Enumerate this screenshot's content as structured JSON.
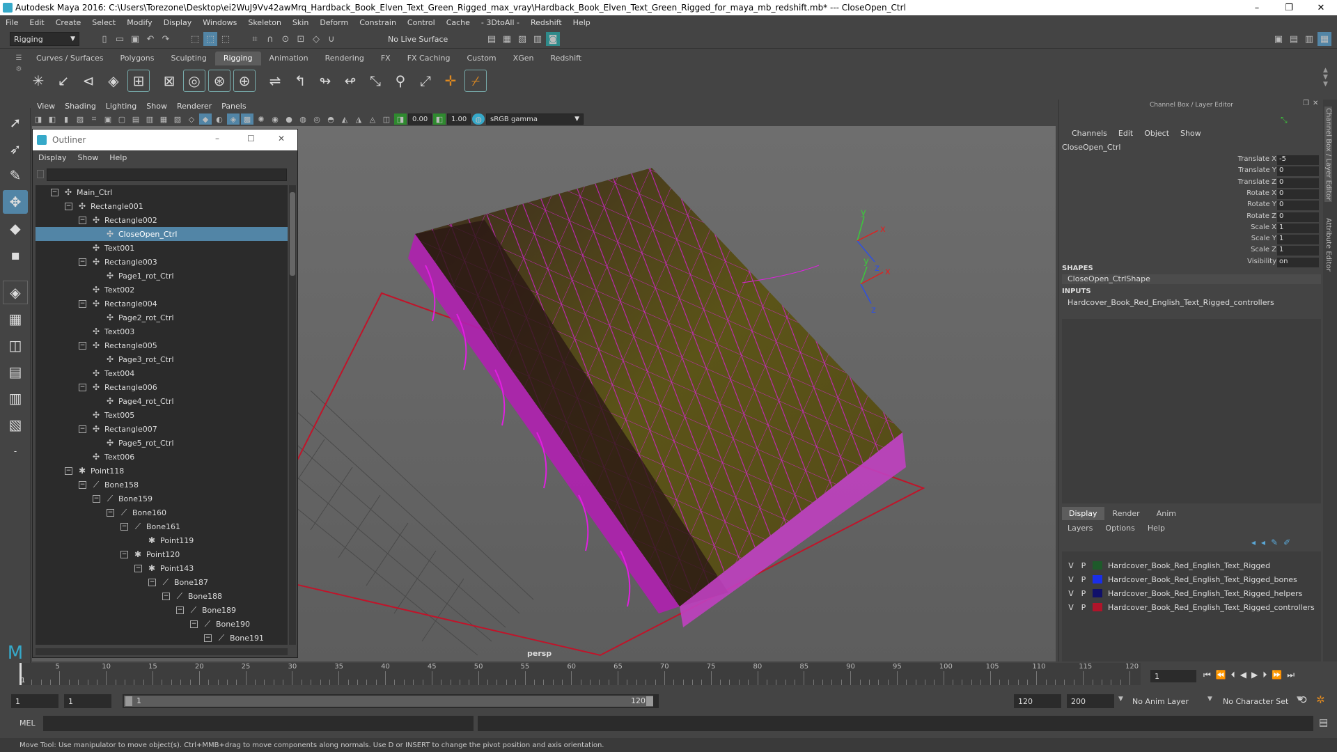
{
  "window": {
    "title": "Autodesk Maya 2016: C:\\Users\\Torezone\\Desktop\\ei2WuJ9Vv42awMrq_Hardback_Book_Elven_Text_Green_Rigged_max_vray\\Hardback_Book_Elven_Text_Green_Rigged_for_maya_mb_redshift.mb*   ---   CloseOpen_Ctrl",
    "minimize": "–",
    "maximize": "❐",
    "close": "✕"
  },
  "menubar": [
    "File",
    "Edit",
    "Create",
    "Select",
    "Modify",
    "Display",
    "Windows",
    "Skeleton",
    "Skin",
    "Deform",
    "Constrain",
    "Control",
    "Cache",
    "- 3DtoAll -",
    "Redshift",
    "Help"
  ],
  "toolbar": {
    "mode": "Rigging",
    "live_surface": "No Live Surface"
  },
  "shelf_tabs": [
    "Curves / Surfaces",
    "Polygons",
    "Sculpting",
    "Rigging",
    "Animation",
    "Rendering",
    "FX",
    "FX Caching",
    "Custom",
    "XGen",
    "Redshift"
  ],
  "shelf_active": "Rigging",
  "viewport": {
    "menu": [
      "View",
      "Shading",
      "Lighting",
      "Show",
      "Renderer",
      "Panels"
    ],
    "exposure": "0.00",
    "gamma": "1.00",
    "colorspace": "sRGB gamma",
    "camera_label": "persp"
  },
  "outliner": {
    "title": "Outliner",
    "menu": [
      "Display",
      "Show",
      "Help"
    ],
    "items": [
      {
        "label": "Main_Ctrl",
        "depth": 0,
        "icon": "nurbs-curve-icon",
        "expander": "−"
      },
      {
        "label": "Rectangle001",
        "depth": 1,
        "icon": "nurbs-curve-icon",
        "expander": "−"
      },
      {
        "label": "Rectangle002",
        "depth": 2,
        "icon": "nurbs-curve-icon",
        "expander": "−"
      },
      {
        "label": "CloseOpen_Ctrl",
        "depth": 3,
        "icon": "nurbs-curve-icon",
        "expander": "",
        "selected": true
      },
      {
        "label": "Text001",
        "depth": 2,
        "icon": "nurbs-curve-icon",
        "expander": ""
      },
      {
        "label": "Rectangle003",
        "depth": 2,
        "icon": "nurbs-curve-icon",
        "expander": "−"
      },
      {
        "label": "Page1_rot_Ctrl",
        "depth": 3,
        "icon": "nurbs-curve-icon",
        "expander": ""
      },
      {
        "label": "Text002",
        "depth": 2,
        "icon": "nurbs-curve-icon",
        "expander": ""
      },
      {
        "label": "Rectangle004",
        "depth": 2,
        "icon": "nurbs-curve-icon",
        "expander": "−"
      },
      {
        "label": "Page2_rot_Ctrl",
        "depth": 3,
        "icon": "nurbs-curve-icon",
        "expander": ""
      },
      {
        "label": "Text003",
        "depth": 2,
        "icon": "nurbs-curve-icon",
        "expander": ""
      },
      {
        "label": "Rectangle005",
        "depth": 2,
        "icon": "nurbs-curve-icon",
        "expander": "−"
      },
      {
        "label": "Page3_rot_Ctrl",
        "depth": 3,
        "icon": "nurbs-curve-icon",
        "expander": ""
      },
      {
        "label": "Text004",
        "depth": 2,
        "icon": "nurbs-curve-icon",
        "expander": ""
      },
      {
        "label": "Rectangle006",
        "depth": 2,
        "icon": "nurbs-curve-icon",
        "expander": "−"
      },
      {
        "label": "Page4_rot_Ctrl",
        "depth": 3,
        "icon": "nurbs-curve-icon",
        "expander": ""
      },
      {
        "label": "Text005",
        "depth": 2,
        "icon": "nurbs-curve-icon",
        "expander": ""
      },
      {
        "label": "Rectangle007",
        "depth": 2,
        "icon": "nurbs-curve-icon",
        "expander": "−"
      },
      {
        "label": "Page5_rot_Ctrl",
        "depth": 3,
        "icon": "nurbs-curve-icon",
        "expander": ""
      },
      {
        "label": "Text006",
        "depth": 2,
        "icon": "nurbs-curve-icon",
        "expander": ""
      },
      {
        "label": "Point118",
        "depth": 1,
        "icon": "point-helper-icon",
        "expander": "−"
      },
      {
        "label": "Bone158",
        "depth": 2,
        "icon": "joint-icon",
        "expander": "−"
      },
      {
        "label": "Bone159",
        "depth": 3,
        "icon": "joint-icon",
        "expander": "−"
      },
      {
        "label": "Bone160",
        "depth": 4,
        "icon": "joint-icon",
        "expander": "−"
      },
      {
        "label": "Bone161",
        "depth": 5,
        "icon": "joint-icon",
        "expander": "−"
      },
      {
        "label": "Point119",
        "depth": 6,
        "icon": "point-helper-icon",
        "expander": ""
      },
      {
        "label": "Point120",
        "depth": 5,
        "icon": "point-helper-icon",
        "expander": "−"
      },
      {
        "label": "Point143",
        "depth": 6,
        "icon": "point-helper-icon",
        "expander": "−"
      },
      {
        "label": "Bone187",
        "depth": 7,
        "icon": "joint-icon",
        "expander": "−"
      },
      {
        "label": "Bone188",
        "depth": 8,
        "icon": "joint-icon",
        "expander": "−"
      },
      {
        "label": "Bone189",
        "depth": 9,
        "icon": "joint-icon",
        "expander": "−"
      },
      {
        "label": "Bone190",
        "depth": 10,
        "icon": "joint-icon",
        "expander": "−"
      },
      {
        "label": "Bone191",
        "depth": 11,
        "icon": "joint-icon",
        "expander": "−"
      }
    ]
  },
  "channel_box": {
    "title": "Channel Box / Layer Editor",
    "menu": [
      "Channels",
      "Edit",
      "Object",
      "Show"
    ],
    "object": "CloseOpen_Ctrl",
    "attributes": [
      {
        "name": "Translate X",
        "value": "-5"
      },
      {
        "name": "Translate Y",
        "value": "0"
      },
      {
        "name": "Translate Z",
        "value": "0"
      },
      {
        "name": "Rotate X",
        "value": "0"
      },
      {
        "name": "Rotate Y",
        "value": "0"
      },
      {
        "name": "Rotate Z",
        "value": "0"
      },
      {
        "name": "Scale X",
        "value": "1"
      },
      {
        "name": "Scale Y",
        "value": "1"
      },
      {
        "name": "Scale Z",
        "value": "1"
      },
      {
        "name": "Visibility",
        "value": "on"
      }
    ],
    "shapes_header": "SHAPES",
    "shape": "CloseOpen_CtrlShape",
    "inputs_header": "INPUTS",
    "input": "Hardcover_Book_Red_English_Text_Rigged_controllers"
  },
  "side_tabs": [
    "Channel Box / Layer Editor",
    "Attribute Editor"
  ],
  "layer_editor": {
    "tabs": [
      "Display",
      "Render",
      "Anim"
    ],
    "active_tab": "Display",
    "menu": [
      "Layers",
      "Options",
      "Help"
    ],
    "layers": [
      {
        "v": "V",
        "p": "P",
        "name": "Hardcover_Book_Red_English_Text_Rigged",
        "color": "#1e5a2a"
      },
      {
        "v": "V",
        "p": "P",
        "name": "Hardcover_Book_Red_English_Text_Rigged_bones",
        "color": "#1a2ee8"
      },
      {
        "v": "V",
        "p": "P",
        "name": "Hardcover_Book_Red_English_Text_Rigged_helpers",
        "color": "#10106a"
      },
      {
        "v": "V",
        "p": "P",
        "name": "Hardcover_Book_Red_English_Text_Rigged_controllers",
        "color": "#b0142a"
      }
    ]
  },
  "timeline": {
    "ticks": [
      "5",
      "10",
      "15",
      "20",
      "25",
      "30",
      "35",
      "40",
      "45",
      "50",
      "55",
      "60",
      "65",
      "70",
      "75",
      "80",
      "85",
      "90",
      "95",
      "100",
      "105",
      "110",
      "115",
      "120"
    ],
    "current_frame": "1",
    "start_label": "1"
  },
  "range": {
    "start": "1",
    "playback_start": "1",
    "slider_start": "1",
    "slider_end": "120",
    "playback_end": "120",
    "end": "200",
    "anim_layer": "No Anim Layer",
    "character_set": "No Character Set"
  },
  "command": {
    "label": "MEL"
  },
  "help_line": "Move Tool: Use manipulator to move object(s). Ctrl+MMB+drag to move components along normals. Use D or INSERT to change the pivot position and axis orientation.",
  "axis_labels": {
    "x": "x",
    "y": "y",
    "z": "z"
  },
  "colors": {
    "wireframe": "#e020e0",
    "selection": "#5285a6",
    "controller": "#c0142a"
  }
}
